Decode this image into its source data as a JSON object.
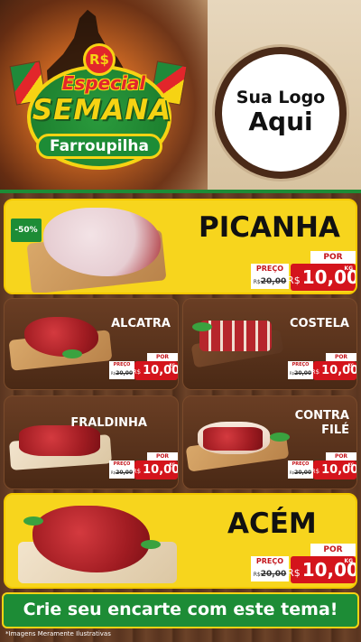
{
  "header": {
    "badge_symbol": "R$",
    "badge_line1": "Especial",
    "badge_line2": "SEMANA",
    "badge_line3": "Farroupilha",
    "logo_line1": "Sua Logo",
    "logo_line2": "Aqui"
  },
  "colors": {
    "green": "#1d8c36",
    "yellow": "#f7d51d",
    "red": "#d4141c",
    "wood": "#5a3520"
  },
  "products": {
    "picanha": {
      "name": "PICANHA",
      "discount": "-50%",
      "por_label": "POR",
      "preco_label": "PREÇO",
      "old_prefix": "R$",
      "old_price": "20,00",
      "currency": "R$",
      "new_price": "10,00",
      "unit": "KG"
    },
    "alcatra": {
      "name": "ALCATRA",
      "por_label": "POR",
      "preco_label": "PREÇO",
      "old_prefix": "R$",
      "old_price": "20,00",
      "currency": "R$",
      "new_price": "10,00",
      "unit": "KG"
    },
    "costela": {
      "name": "COSTELA",
      "por_label": "POR",
      "preco_label": "PREÇO",
      "old_prefix": "R$",
      "old_price": "20,00",
      "currency": "R$",
      "new_price": "10,00",
      "unit": "KG"
    },
    "fraldinha": {
      "name": "FRALDINHA",
      "por_label": "POR",
      "preco_label": "PREÇO",
      "old_prefix": "R$",
      "old_price": "20,00",
      "currency": "R$",
      "new_price": "10,00",
      "unit": "KG"
    },
    "contra_file": {
      "name_line1": "CONTRA",
      "name_line2": "FILÉ",
      "por_label": "POR",
      "preco_label": "PREÇO",
      "old_prefix": "R$",
      "old_price": "20,00",
      "currency": "R$",
      "new_price": "10,00",
      "unit": "KG"
    },
    "acem": {
      "name": "ACÉM",
      "por_label": "POR",
      "preco_label": "PREÇO",
      "old_prefix": "R$",
      "old_price": "20,00",
      "currency": "R$",
      "new_price": "10,00",
      "unit": "KG"
    }
  },
  "footer": {
    "cta": "Crie seu encarte com este tema!",
    "disclaimer": "*Imagens Meramente Ilustrativas"
  }
}
